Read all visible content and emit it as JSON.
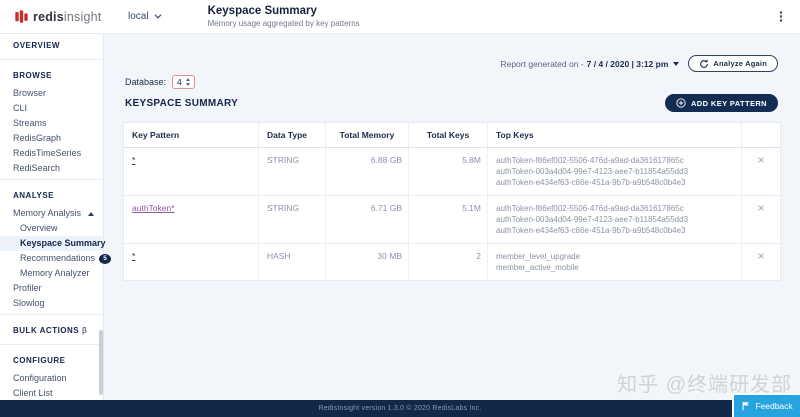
{
  "colors": {
    "brand_red": "#c6302b",
    "navy": "#13264d",
    "main_background": "#f2f5fa",
    "feedback_blue": "#27a4e0",
    "database_select_border": "#de9191",
    "visited_link_purple": "#8d59a5",
    "footer_navy": "#132849"
  },
  "icons": {
    "logo": "redis-mark",
    "connection_chevron": "chevron-down",
    "overflow_menu": "kebab-vertical",
    "report_caret": "caret-down",
    "analyze_again": "refresh",
    "database_spinner": "select-arrows",
    "add_key_pattern": "plus-circle",
    "collapse_memory_analysis": "triangle-up",
    "remove_row": "×",
    "feedback": "flag"
  },
  "header": {
    "logo_bold": "redis",
    "logo_light": "insight",
    "connection": "local",
    "title": "Keyspace Summary",
    "subtitle": "Memory usage aggregated by key patterns"
  },
  "sidebar": {
    "sections": {
      "overview": "OVERVIEW",
      "browse": "BROWSE",
      "analyse": "ANALYSE",
      "bulk_actions": "BULK ACTIONS",
      "bulk_actions_beta": "β",
      "configure": "CONFIGURE"
    },
    "browse_items": [
      "Browser",
      "CLI",
      "Streams",
      "RedisGraph",
      "RedisTimeSeries",
      "RediSearch"
    ],
    "memory_analysis": "Memory Analysis",
    "memory_analysis_items": [
      "Overview",
      "Keyspace Summary",
      "Recommendations",
      "Memory Analyzer"
    ],
    "recommendations_badge": "5",
    "analyse_items": [
      "Profiler",
      "Slowlog"
    ],
    "configure_items": [
      "Configuration",
      "Client List"
    ]
  },
  "toolbar": {
    "report_label": "Report generated on -",
    "report_value": "7 / 4 / 2020 | 3:12 pm",
    "analyze_again": "Analyze Again",
    "database_label": "Database:",
    "database_value": "4",
    "section_title": "KEYSPACE SUMMARY",
    "add_key_pattern": "ADD KEY PATTERN"
  },
  "table": {
    "columns": [
      "Key Pattern",
      "Data Type",
      "Total Memory",
      "Total Keys",
      "Top Keys"
    ],
    "rows": [
      {
        "key_pattern": "*",
        "data_type": "STRING",
        "total_memory": "6.88 GB",
        "total_keys": "5.8M",
        "top_keys": [
          "authToken-f86ef002-5506-476d-a9ad-da361617865c",
          "authToken-003a4d04-99e7-4123-aee7-b11854a55dd3",
          "authToken-e434ef63-c86e-451a-9b7b-a9b548c0b4e3"
        ]
      },
      {
        "key_pattern": "authToken*",
        "data_type": "STRING",
        "total_memory": "6.71 GB",
        "total_keys": "5.1M",
        "top_keys": [
          "authToken-f86ef002-5506-476d-a9ad-da361617865c",
          "authToken-003a4d04-99e7-4123-aee7-b11854a55dd3",
          "authToken-e434ef63-c86e-451a-9b7b-a9b548c0b4e3"
        ]
      },
      {
        "key_pattern": "*",
        "data_type": "HASH",
        "total_memory": "30 MB",
        "total_keys": "2",
        "top_keys": [
          "member_level_upgrade",
          "member_active_mobile"
        ]
      }
    ]
  },
  "footer": {
    "version_text": "RedisInsight version 1.3.0 © 2020 RedisLabs Inc.",
    "feedback_label": "Feedback"
  },
  "watermark": {
    "text": "知乎 @终端研发部"
  }
}
